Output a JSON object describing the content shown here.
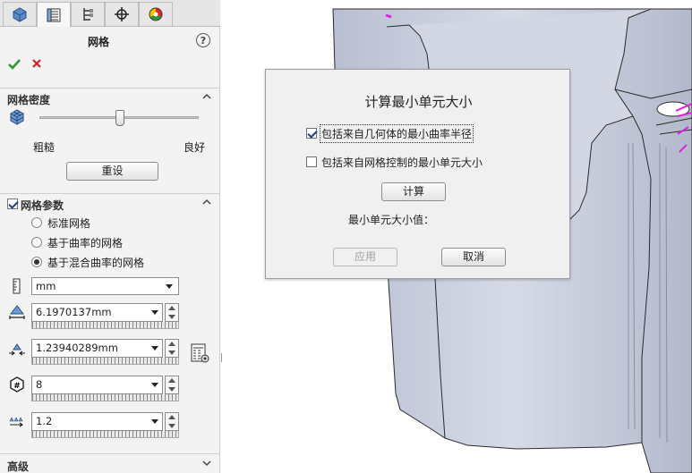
{
  "panel": {
    "title": "网格",
    "help_symbol": "?",
    "tabs": [
      {
        "icon": "feature-manager-icon"
      },
      {
        "icon": "property-manager-icon",
        "active": true
      },
      {
        "icon": "configuration-manager-icon"
      },
      {
        "icon": "origin-target-icon"
      },
      {
        "icon": "appearance-icon"
      }
    ],
    "density": {
      "header": "网格密度",
      "coarse_label": "粗糙",
      "fine_label": "良好",
      "reset_label": "重设",
      "slider_value": 0.5
    },
    "params": {
      "header": "网格参数",
      "enabled": true,
      "radio_standard": "标准网格",
      "radio_curvature": "基于曲率的网格",
      "radio_blended": "基于混合曲率的网格",
      "selected": "radio_blended",
      "unit": "mm",
      "max_element_size": "6.1970137mm",
      "min_element_size": "1.23940289mm",
      "min_elements_in_circle": "8",
      "growth_ratio": "1.2"
    },
    "advanced_header": "高级"
  },
  "dialog": {
    "title": "计算最小单元大小",
    "check_geometry_label": "包括来自几何体的最小曲率半径",
    "check_geometry": true,
    "check_mesh_control_label": "包括来自网格控制的最小单元大小",
    "check_mesh_control": false,
    "calc_label": "计算",
    "result_label": "最小单元大小值：",
    "apply_label": "应用",
    "cancel_label": "取消"
  },
  "colors": {
    "accept_green": "#2e9a2e",
    "cancel_red": "#d42020",
    "model_fill": "#c9cfe0",
    "highlight_magenta": "#e020e0"
  }
}
